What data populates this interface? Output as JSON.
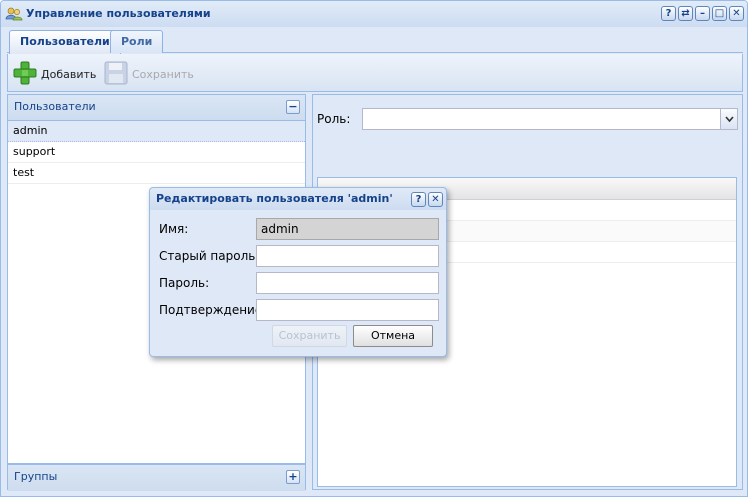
{
  "window": {
    "title": "Управление пользователями"
  },
  "tabs": [
    {
      "label": "Пользователи",
      "active": true
    },
    {
      "label": "Роли",
      "active": false
    }
  ],
  "toolbar": {
    "add_label": "Добавить",
    "save_label": "Сохранить"
  },
  "users_panel": {
    "title": "Пользователи",
    "items": [
      "admin",
      "support",
      "test"
    ],
    "selected": "admin"
  },
  "groups_panel": {
    "title": "Группы"
  },
  "role": {
    "label": "Роль:",
    "value": ""
  },
  "dialog": {
    "title": "Редактировать пользователя 'admin'",
    "fields": {
      "name_label": "Имя:",
      "name_value": "admin",
      "old_password_label": "Старый пароль:",
      "password_label": "Пароль:",
      "confirm_label": "Подтверждение:"
    },
    "save_label": "Сохранить",
    "cancel_label": "Отмена"
  },
  "colors": {
    "accent": "#15428b",
    "border": "#99bbe8",
    "background": "#dfe8f6"
  }
}
